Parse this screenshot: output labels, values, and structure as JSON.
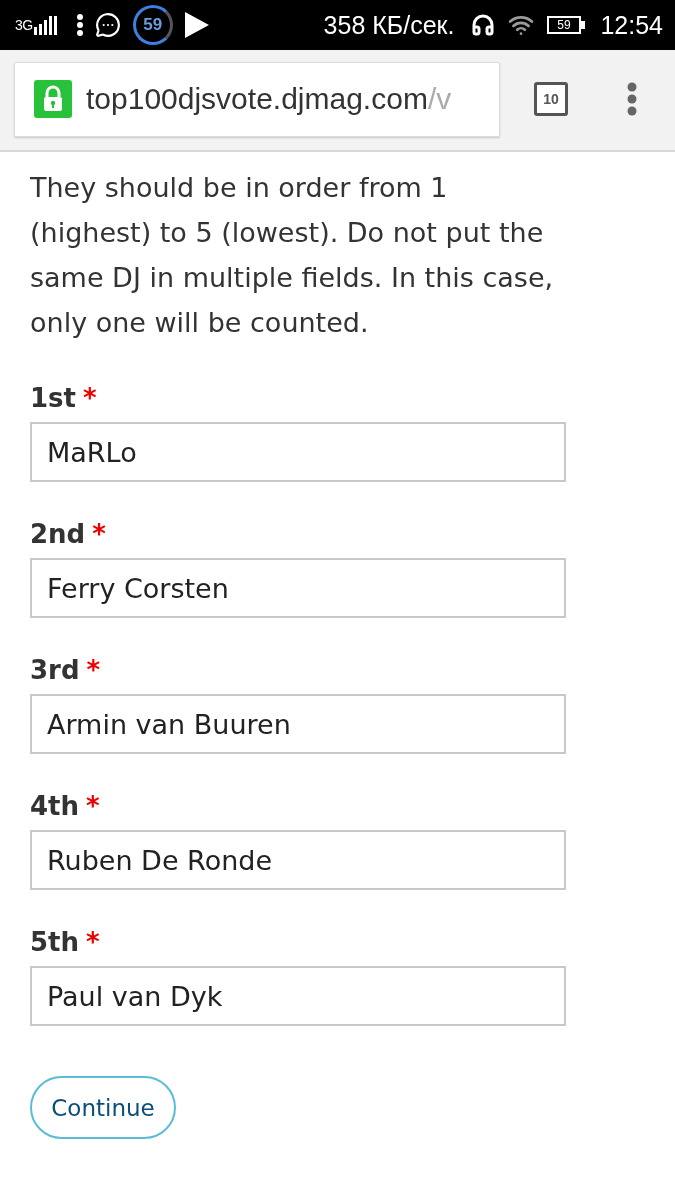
{
  "status_bar": {
    "network_type": "3G",
    "notification_count": "59",
    "download_speed": "358 КБ/сек.",
    "battery": "59",
    "time": "12:54"
  },
  "browser_bar": {
    "url_host": "top100djsvote.djmag.com",
    "url_path": "/v",
    "secure": true,
    "tab_count": "10"
  },
  "instructions": "They should be in order from 1 (highest) to 5 (lowest). Do not put the same DJ in multiple fields. In this case, only one will be counted.",
  "fields": [
    {
      "label": "1st",
      "required_mark": "*",
      "value": "MaRLo"
    },
    {
      "label": "2nd",
      "required_mark": "*",
      "value": "Ferry Corsten"
    },
    {
      "label": "3rd",
      "required_mark": "*",
      "value": "Armin van Buuren"
    },
    {
      "label": "4th",
      "required_mark": "*",
      "value": "Ruben De Ronde"
    },
    {
      "label": "5th",
      "required_mark": "*",
      "value": "Paul van Dyk"
    }
  ],
  "buttons": [
    {
      "label": "Continue"
    }
  ]
}
